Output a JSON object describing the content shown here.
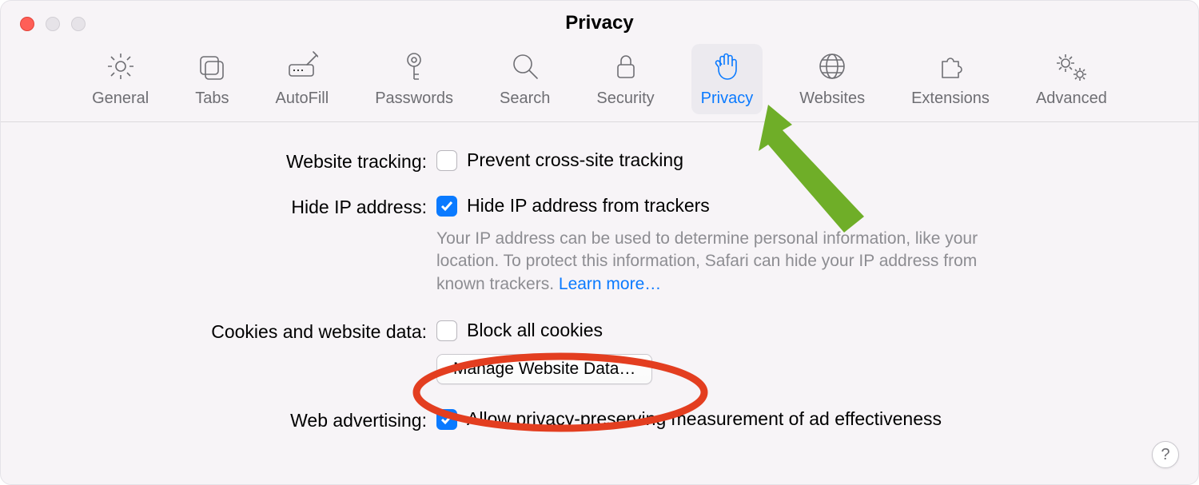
{
  "window": {
    "title": "Privacy"
  },
  "toolbar": {
    "items": [
      {
        "id": "general",
        "label": "General"
      },
      {
        "id": "tabs",
        "label": "Tabs"
      },
      {
        "id": "autofill",
        "label": "AutoFill"
      },
      {
        "id": "passwords",
        "label": "Passwords"
      },
      {
        "id": "search",
        "label": "Search"
      },
      {
        "id": "security",
        "label": "Security"
      },
      {
        "id": "privacy",
        "label": "Privacy"
      },
      {
        "id": "websites",
        "label": "Websites"
      },
      {
        "id": "extensions",
        "label": "Extensions"
      },
      {
        "id": "advanced",
        "label": "Advanced"
      }
    ],
    "selected": "privacy"
  },
  "settings": {
    "website_tracking": {
      "label": "Website tracking:",
      "checkbox_label": "Prevent cross-site tracking",
      "checked": false
    },
    "hide_ip": {
      "label": "Hide IP address:",
      "checkbox_label": "Hide IP address from trackers",
      "checked": true,
      "description": "Your IP address can be used to determine personal information, like your location. To protect this information, Safari can hide your IP address from known trackers. ",
      "learn_more": "Learn more…"
    },
    "cookies": {
      "label": "Cookies and website data:",
      "checkbox_label": "Block all cookies",
      "checked": false,
      "manage_button": "Manage Website Data…"
    },
    "web_advertising": {
      "label": "Web advertising:",
      "checkbox_label": "Allow privacy-preserving measurement of ad effectiveness",
      "checked": true
    }
  },
  "help_button": "?",
  "annotations": {
    "arrow_color": "#6fae28",
    "circle_color": "#e33e20"
  }
}
